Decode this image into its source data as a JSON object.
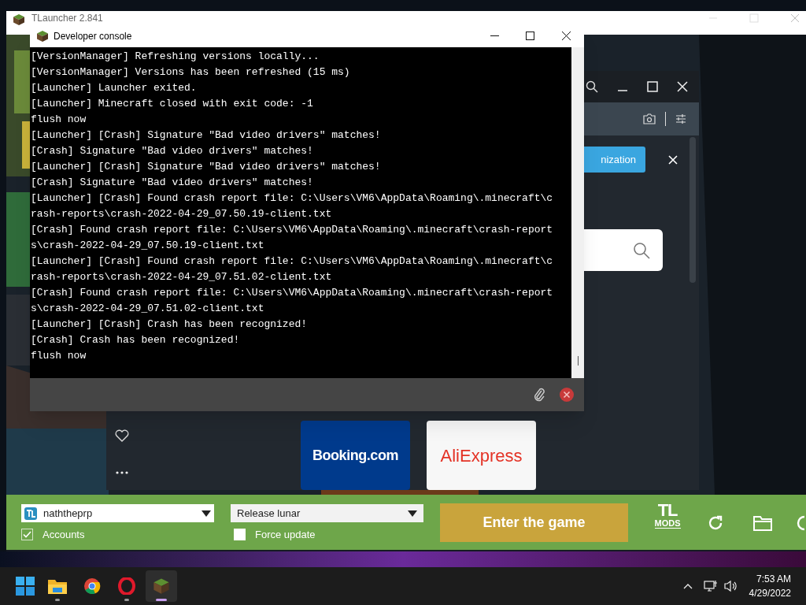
{
  "launcher_window": {
    "title": "TLauncher 2.841"
  },
  "dev_console": {
    "title": "Developer console",
    "lines": [
      "[VersionManager] Refreshing versions locally...",
      "[VersionManager] Versions has been refreshed (15 ms)",
      "[Launcher] Launcher exited.",
      "[Launcher] Minecraft closed with exit code: -1",
      "flush now",
      "[Launcher] [Crash] Signature \"Bad video drivers\" matches!",
      "[Crash] Signature \"Bad video drivers\" matches!",
      "[Launcher] [Crash] Signature \"Bad video drivers\" matches!",
      "[Crash] Signature \"Bad video drivers\" matches!",
      "[Launcher] [Crash] Found crash report file: C:\\Users\\VM6\\AppData\\Roaming\\.minecraft\\c",
      "rash-reports\\crash-2022-04-29_07.50.19-client.txt",
      "[Crash] Found crash report file: C:\\Users\\VM6\\AppData\\Roaming\\.minecraft\\crash-report",
      "s\\crash-2022-04-29_07.50.19-client.txt",
      "[Launcher] [Crash] Found crash report file: C:\\Users\\VM6\\AppData\\Roaming\\.minecraft\\c",
      "rash-reports\\crash-2022-04-29_07.51.02-client.txt",
      "[Crash] Found crash report file: C:\\Users\\VM6\\AppData\\Roaming\\.minecraft\\crash-report",
      "s\\crash-2022-04-29_07.51.02-client.txt",
      "[Launcher] [Crash] Crash has been recognized!",
      "[Crash] Crash has been recognized!",
      "flush now"
    ]
  },
  "browser_panel": {
    "notice_button": "nization"
  },
  "ads": [
    {
      "label": "Booking.com",
      "kind": "booking"
    },
    {
      "label": "AliExpress",
      "kind": "aliexpress"
    }
  ],
  "launcher_bar": {
    "account": "naththeprp",
    "accounts_checkbox": {
      "label": "Accounts",
      "checked": true
    },
    "version": "Release lunar",
    "force_update": {
      "label": "Force update",
      "checked": false
    },
    "play_button": "Enter the game",
    "mods_logo": [
      "TL",
      "MODS"
    ]
  },
  "taskbar": {
    "apps": [
      {
        "kind": "files",
        "running": true,
        "selected": false
      },
      {
        "kind": "chrome",
        "running": false,
        "selected": false
      },
      {
        "kind": "opera",
        "running": true,
        "selected": false
      },
      {
        "kind": "minecraft",
        "running": true,
        "selected": true
      }
    ],
    "time": "7:53 AM",
    "date": "4/29/2022"
  }
}
